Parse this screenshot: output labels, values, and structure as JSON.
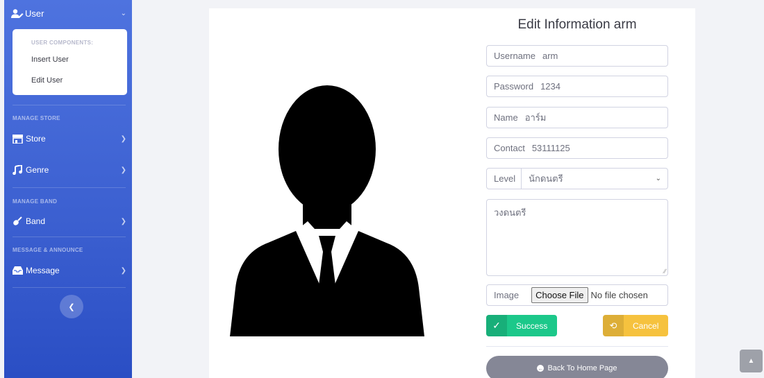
{
  "sidebar": {
    "user_label": "User",
    "user_components_header": "USER COMPONENTS:",
    "user_items": [
      "Insert User",
      "Edit User"
    ],
    "manage_store_header": "MANAGE STORE",
    "store_label": "Store",
    "genre_label": "Genre",
    "manage_band_header": "MANAGE BAND",
    "band_label": "Band",
    "message_header": "MESSAGE & ANNOUNCE",
    "message_label": "Message"
  },
  "form": {
    "title": "Edit Information arm",
    "username_label": "Username",
    "username_value": "arm",
    "password_label": "Password",
    "password_value": "1234",
    "name_label": "Name",
    "name_value": "อาร์ม",
    "contact_label": "Contact",
    "contact_value": "53111125",
    "level_label": "Level",
    "level_value": "นักดนตรี",
    "description_value": "วงดนตรี",
    "image_label": "Image",
    "choose_file_label": "Choose File",
    "no_file_text": "No file chosen",
    "success_label": "Success",
    "cancel_label": "Cancel",
    "back_home_label": "Back To Home Page"
  },
  "colors": {
    "sidebar": "#4e73df",
    "success": "#1cc88a",
    "warning": "#f6c23e",
    "secondary": "#858796"
  }
}
